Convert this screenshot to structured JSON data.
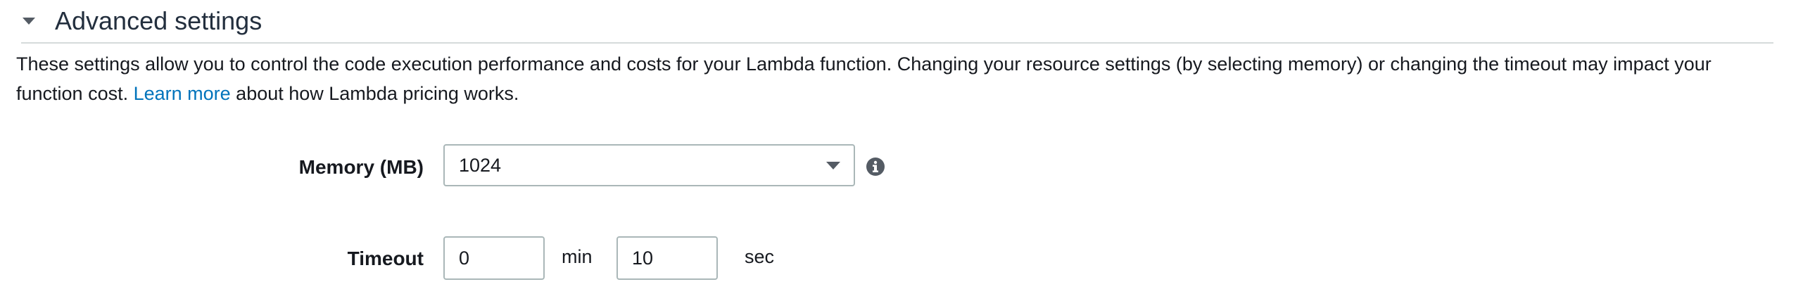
{
  "section": {
    "title": "Advanced settings",
    "description_before_link": "These settings allow you to control the code execution performance and costs for your Lambda function. Changing your resource settings (by selecting memory) or changing the timeout may impact your function cost. ",
    "learn_more_link": "Learn more",
    "description_after_link": " about how Lambda pricing works."
  },
  "memory": {
    "label": "Memory (MB)",
    "selected_value": "1024",
    "icon": "info-icon"
  },
  "timeout": {
    "label": "Timeout",
    "minutes_value": "0",
    "minutes_unit": "min",
    "seconds_value": "10",
    "seconds_unit": "sec"
  },
  "colors": {
    "link": "#0073bb",
    "border": "#aab7b8",
    "text": "#16191f"
  }
}
